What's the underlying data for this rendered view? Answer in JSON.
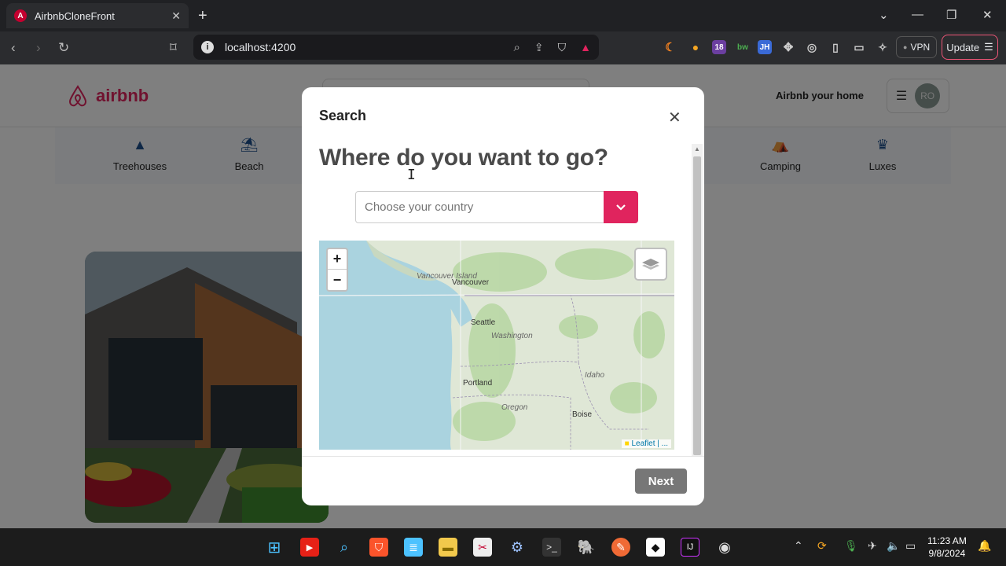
{
  "browser": {
    "tab_title": "AirbnbCloneFront",
    "tab_close": "✕",
    "new_tab": "+",
    "url": "localhost:4200",
    "vpn_label": "VPN",
    "update_label": "Update",
    "ext_badge": "18",
    "ext_jh": "JH",
    "ext_bw": "bw"
  },
  "app": {
    "brand": "airbnb",
    "host_link": "Airbnb your home",
    "avatar_initials": "RO",
    "categories": [
      {
        "label": "Treehouses",
        "icon": "tree-icon"
      },
      {
        "label": "Beach",
        "icon": "umbrella-icon"
      },
      {
        "label": "Camping",
        "icon": "tent-icon"
      },
      {
        "label": "Luxes",
        "icon": "luxe-icon"
      }
    ]
  },
  "modal": {
    "title": "Search",
    "heading": "Where do you want to go?",
    "country_placeholder": "Choose your country",
    "next_label": "Next",
    "map": {
      "zoom_in": "+",
      "zoom_out": "−",
      "attribution": "Leaflet | ...",
      "labels": {
        "vancouver_island": "Vancouver Island",
        "vancouver": "Vancouver",
        "seattle": "Seattle",
        "washington": "Washington",
        "portland": "Portland",
        "oregon": "Oregon",
        "idaho": "Idaho",
        "boise": "Boise"
      }
    }
  },
  "taskbar": {
    "time": "11:23 AM",
    "date": "9/8/2024"
  },
  "colors": {
    "brand": "#e0245e",
    "category_icon": "#1d4f8c"
  }
}
